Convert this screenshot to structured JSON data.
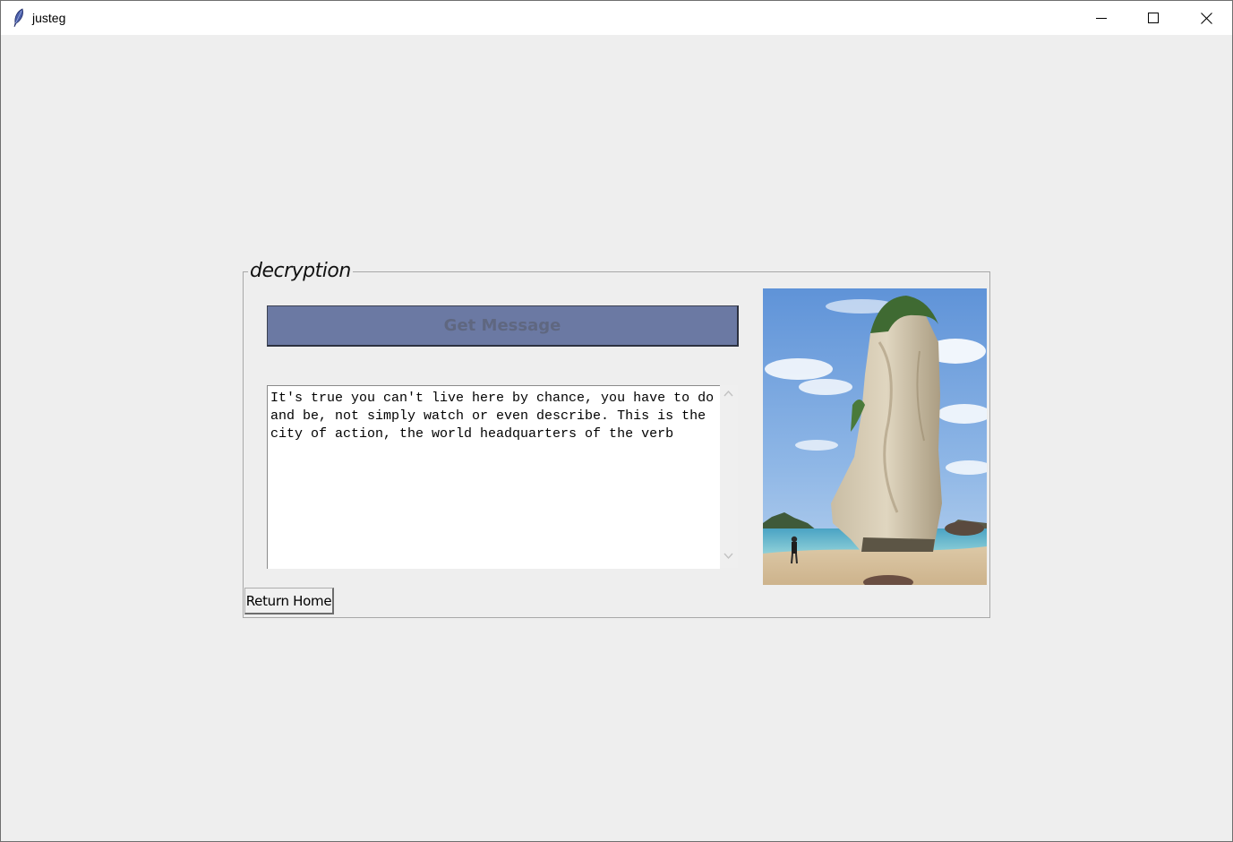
{
  "window": {
    "title": "justeg",
    "controls": {
      "minimize": "minimize-icon",
      "maximize": "maximize-icon",
      "close": "close-icon"
    }
  },
  "frame": {
    "label": "decryption"
  },
  "get_message_button": {
    "label": "Get Message",
    "bg_color": "#6b79a3"
  },
  "message_box": {
    "text": "It's true you can't live here by chance, you have to do and be, not simply watch or even describe. This is the city of action, the world headquarters of the verb"
  },
  "image": {
    "subject": "sea-stack-rock-on-beach"
  },
  "return_home_button": {
    "label": "Return Home"
  }
}
